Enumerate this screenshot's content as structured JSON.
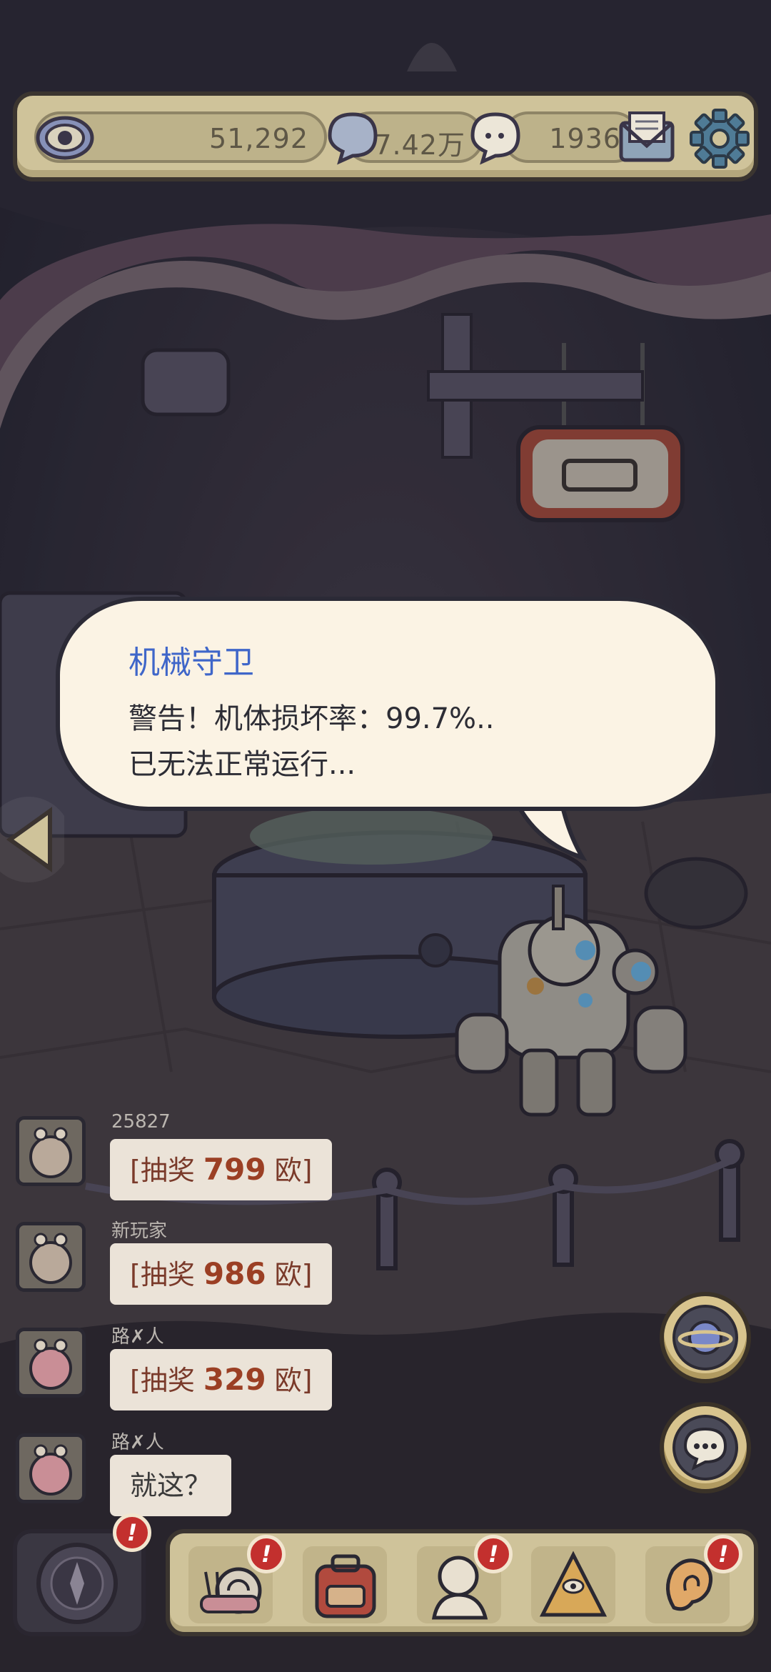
{
  "stats": {
    "vision": "51,292",
    "bubbles": "7.42万",
    "chat_count": "1936"
  },
  "dialog": {
    "speaker": "机械守卫",
    "line1": "警告！机体损坏率：99.7%..",
    "line2": "已无法正常运行..."
  },
  "chat": [
    {
      "name": "25827",
      "prefix": "[抽奖 ",
      "num": "799",
      "suffix": " 欧]"
    },
    {
      "name": "新玩家",
      "prefix": "[抽奖 ",
      "num": "986",
      "suffix": " 欧]"
    },
    {
      "name": "路✗人",
      "prefix": "[抽奖 ",
      "num": "329",
      "suffix": " 欧]"
    },
    {
      "name": "路✗人",
      "text": "就这？"
    }
  ],
  "badges": {
    "mark": "!"
  },
  "icons": {
    "top": [
      "eye-icon",
      "speech-bubble-icon",
      "chat-bubble-icon",
      "mail-icon",
      "gear-icon"
    ],
    "right": [
      "planet-icon",
      "chat-icon"
    ],
    "bottom": [
      "compass-icon",
      "snail-icon",
      "backpack-icon",
      "statue-icon",
      "pyramid-icon",
      "ear-icon"
    ]
  },
  "colors": {
    "panel": "#cfc39a",
    "speaker": "#3f66c9",
    "badge": "#c3302e"
  }
}
